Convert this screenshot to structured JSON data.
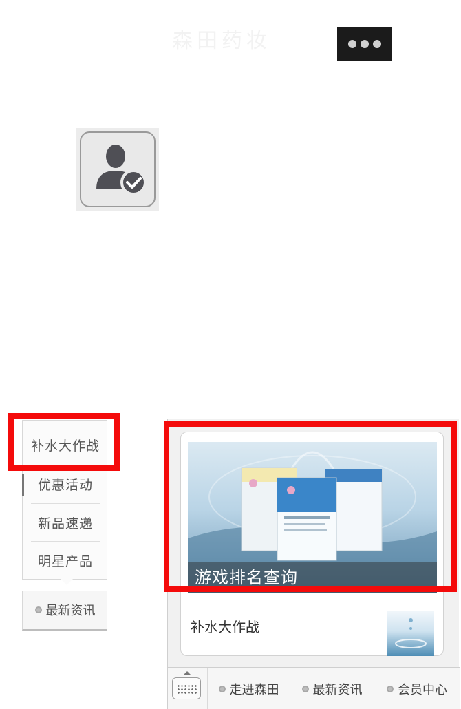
{
  "top_bar": {
    "faint_title": "森田药妆",
    "more_icon": "more-dots-icon"
  },
  "contact": {
    "icon": "verified-contact-icon"
  },
  "left_menu": {
    "items": [
      "补水大作战",
      "优惠活动",
      "新品速递",
      "明星产品"
    ],
    "bottom_tab": "最新资讯"
  },
  "article": {
    "banner_caption": "游戏排名查询",
    "item_title": "补水大作战"
  },
  "bottom_bar": {
    "keyboard_icon": "keyboard-icon",
    "tabs": [
      "走进森田",
      "最新资讯",
      "会员中心"
    ]
  },
  "colors": {
    "highlight": "#f40b0b",
    "dark_button": "#1b1b1b"
  }
}
